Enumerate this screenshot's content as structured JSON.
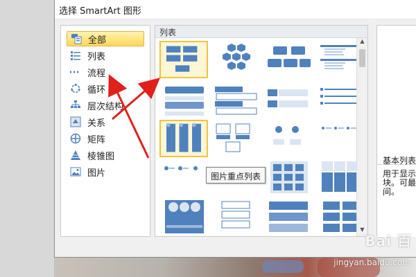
{
  "window": {
    "title": "选择 SmartArt 图形"
  },
  "categories": [
    {
      "label": "全部",
      "icon": "all-grid-icon",
      "selected": true
    },
    {
      "label": "列表",
      "icon": "list-icon"
    },
    {
      "label": "流程",
      "icon": "process-icon"
    },
    {
      "label": "循环",
      "icon": "cycle-icon"
    },
    {
      "label": "层次结构",
      "icon": "hierarchy-icon"
    },
    {
      "label": "关系",
      "icon": "relationship-icon"
    },
    {
      "label": "矩阵",
      "icon": "matrix-icon"
    },
    {
      "label": "棱锥图",
      "icon": "pyramid-icon"
    },
    {
      "label": "图片",
      "icon": "picture-icon"
    }
  ],
  "gallery": {
    "header": "列表",
    "tooltip": "图片重点列表",
    "accent": "#4f81bd",
    "selected_index": 0,
    "hover_index": 8
  },
  "preview": {
    "title": "基本列表",
    "description": "用于显示\n块。可最\n间。",
    "colors": [
      "#d03a36",
      "#7e45a6"
    ]
  },
  "watermark": {
    "logo": "Bai 百",
    "url": "jingyan.baidu.com"
  },
  "annotation": {
    "arrow_color": "#e0201b"
  }
}
